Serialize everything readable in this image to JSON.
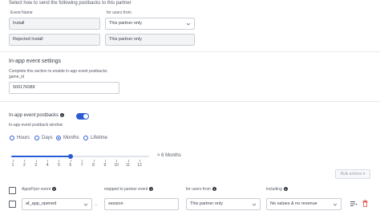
{
  "postbacks": {
    "instruction": "Select how to send the following postbacks to this partner",
    "event_name_header": "Event Name",
    "users_from_header": "for users from",
    "rows": [
      {
        "event": "Install",
        "users_from": "This partner only"
      },
      {
        "event": "Rejected Install",
        "users_from": "This partner only"
      }
    ]
  },
  "inapp_settings": {
    "title": "In-app event settings",
    "help_line1": "Complete this section to enable in-app event postbacks",
    "help_line2": "game_id",
    "game_id_value": "500176088"
  },
  "inapp_postbacks": {
    "title": "In-app event postbacks",
    "window_label": "In-app event postback window",
    "toggle_on": true,
    "radio_options": [
      "Hours",
      "Days",
      "Months",
      "Lifetime"
    ],
    "selected_option": "Months",
    "slider_value": 6,
    "slider_max_label": "> 6 Months",
    "slider_ticks": [
      "1",
      "2",
      "3",
      "4",
      "5",
      "6",
      "7",
      "8",
      "9",
      "10",
      "11",
      "12"
    ],
    "bulk_actions_label": "Bulk actions",
    "table": {
      "col_appsflyer": "AppsFlyer event",
      "col_mapped": "mapped to partner event",
      "col_users_from": "for users from",
      "col_including": "including",
      "row": {
        "appsflyer_event": "af_app_opened",
        "partner_event": "session",
        "users_from": "This partner only",
        "including": "No values & no revenue"
      }
    }
  },
  "colors": {
    "accent": "#2a5bd7",
    "delete": "#e0443c",
    "border": "#c9ced6"
  }
}
